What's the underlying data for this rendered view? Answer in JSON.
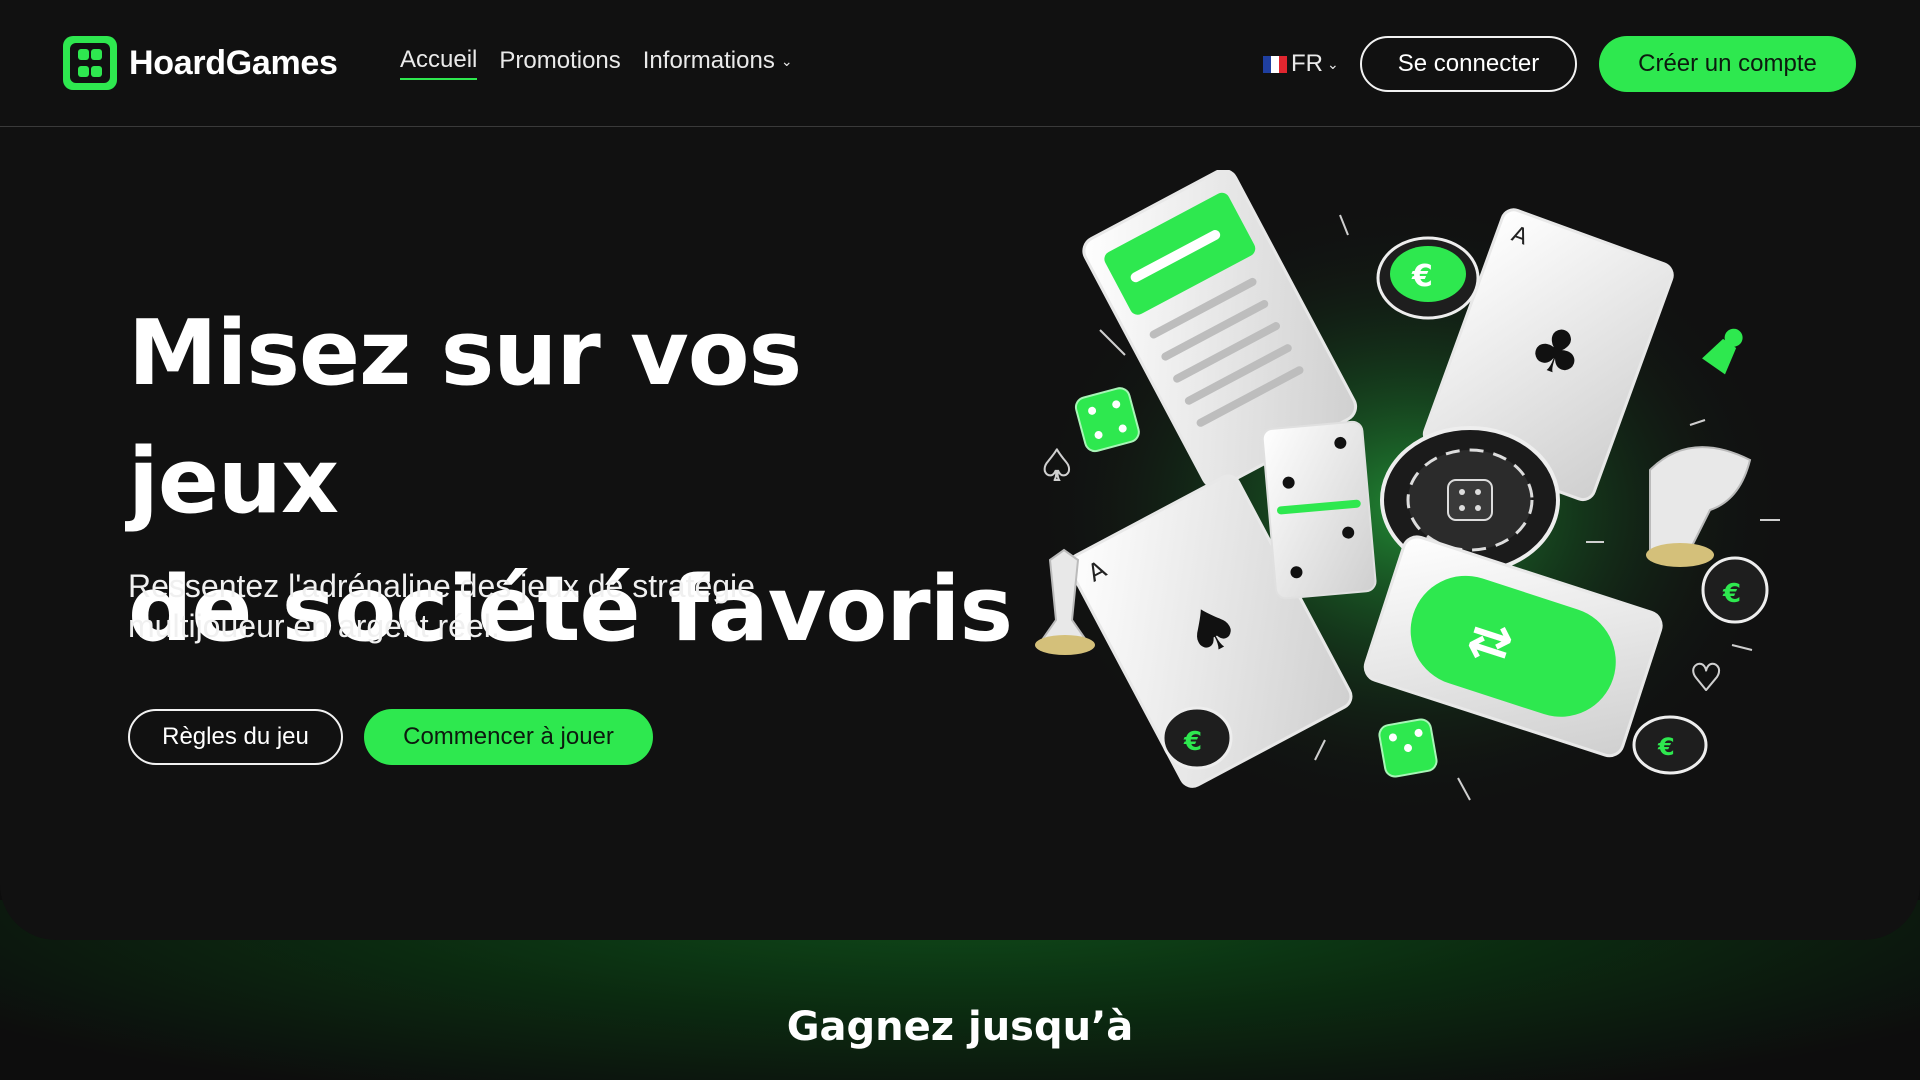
{
  "brand": {
    "name": "HoardGames",
    "accent": "#2ee84f"
  },
  "nav": {
    "items": [
      {
        "label": "Accueil",
        "active": true
      },
      {
        "label": "Promotions",
        "active": false
      },
      {
        "label": "Informations",
        "active": false,
        "dropdown": true
      }
    ]
  },
  "header": {
    "language": "FR",
    "login_label": "Se connecter",
    "signup_label": "Créer un compte"
  },
  "hero": {
    "title_line1": "Misez sur vos jeux",
    "title_line2": "de société favoris",
    "subtitle_line1": "Ressentez l'adrénaline des jeux de stratégie",
    "subtitle_line2": "multijoueur en argent réel.",
    "rules_label": "Règles du jeu",
    "play_label": "Commencer à jouer"
  },
  "section": {
    "title": "Gagnez jusqu’à"
  },
  "icons": [
    "dice-logo-icon",
    "chevron-down-icon",
    "flag-fr-icon"
  ]
}
